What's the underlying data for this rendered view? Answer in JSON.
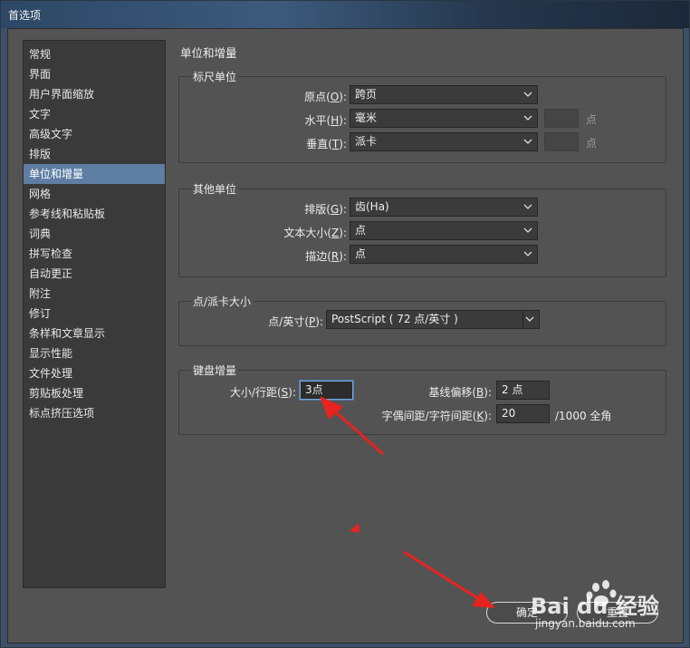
{
  "window": {
    "title": "首选项"
  },
  "sidebar": {
    "items": [
      {
        "label": "常规"
      },
      {
        "label": "界面"
      },
      {
        "label": "用户界面缩放"
      },
      {
        "label": "文字"
      },
      {
        "label": "高级文字"
      },
      {
        "label": "排版"
      },
      {
        "label": "单位和增量",
        "selected": true
      },
      {
        "label": "网格"
      },
      {
        "label": "参考线和粘贴板"
      },
      {
        "label": "词典"
      },
      {
        "label": "拼写检查"
      },
      {
        "label": "自动更正"
      },
      {
        "label": "附注"
      },
      {
        "label": "修订"
      },
      {
        "label": "条样和文章显示"
      },
      {
        "label": "显示性能"
      },
      {
        "label": "文件处理"
      },
      {
        "label": "剪贴板处理"
      },
      {
        "label": "标点挤压选项"
      }
    ]
  },
  "panel": {
    "heading": "单位和增量"
  },
  "ruler_units": {
    "group_label": "标尺单位",
    "origin": {
      "label": "原点",
      "key": "O",
      "value": "跨页"
    },
    "horizontal": {
      "label": "水平",
      "key": "H",
      "value": "毫米",
      "unit": "点"
    },
    "vertical": {
      "label": "垂直",
      "key": "T",
      "value": "派卡",
      "unit": "点"
    }
  },
  "other_units": {
    "group_label": "其他单位",
    "composition": {
      "label": "排版",
      "key": "G",
      "value": "齿(Ha)"
    },
    "text_size": {
      "label": "文本大小",
      "key": "Z",
      "value": "点"
    },
    "stroke": {
      "label": "描边",
      "key": "R",
      "value": "点"
    }
  },
  "point_pica": {
    "group_label": "点/派卡大小",
    "points_inch": {
      "label": "点/英寸",
      "key": "P",
      "value": "PostScript ( 72 点/英寸 )"
    }
  },
  "keyboard": {
    "group_label": "键盘增量",
    "size_leading": {
      "label": "大小/行距",
      "key": "S",
      "value": "3点"
    },
    "baseline_shift": {
      "label": "基线偏移",
      "key": "B",
      "value": "2 点"
    },
    "kerning": {
      "label": "字偶间距/字符间距",
      "key": "K",
      "value": "20",
      "suffix": "/1000 全角"
    }
  },
  "buttons": {
    "ok": "确定",
    "reset": "重置"
  },
  "watermark": {
    "logo": "Bai du 经验",
    "url": "jingyan.baidu.com"
  },
  "colors": {
    "selection": "#5e7ea3",
    "annotation_arrow": "#e8231f",
    "focus": "#7aa7d6"
  }
}
